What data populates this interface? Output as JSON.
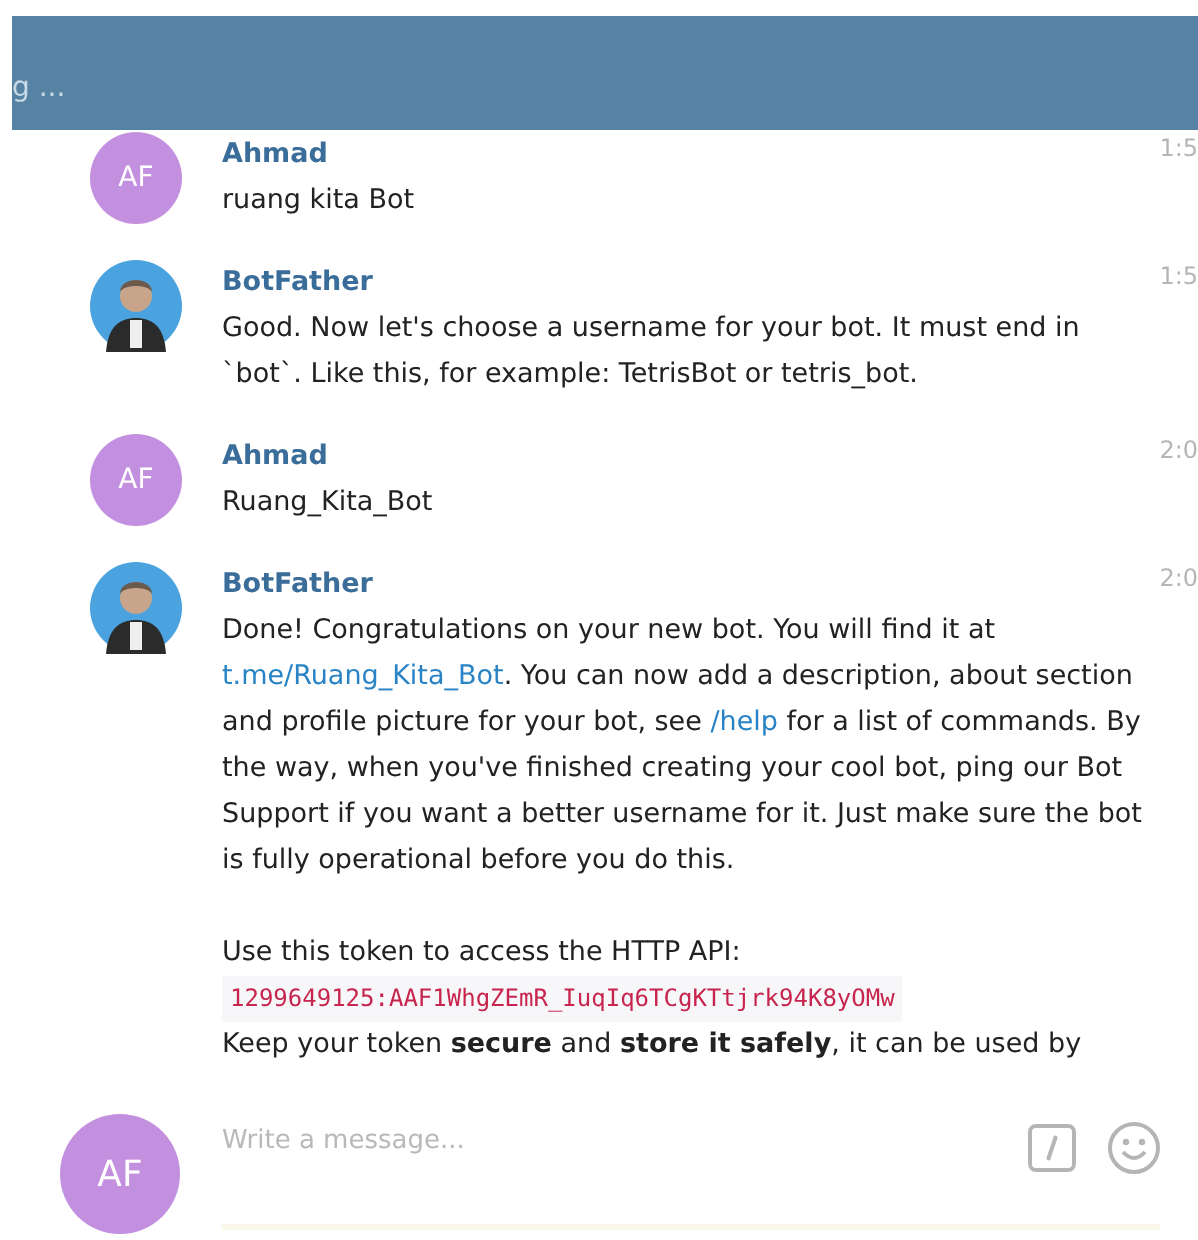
{
  "header": {
    "status": "g ..."
  },
  "messages": [
    {
      "sender": "Ahmad",
      "time": "1:5",
      "avatar": {
        "kind": "initials",
        "initials": "AF"
      },
      "blocks": [
        {
          "kind": "text",
          "text": "ruang kita Bot"
        }
      ]
    },
    {
      "sender": "BotFather",
      "time": "1:5",
      "avatar": {
        "kind": "photo"
      },
      "blocks": [
        {
          "kind": "text",
          "text": "Good. Now let's choose a username for your bot. It must end in `bot`. Like this, for example: TetrisBot or tetris_bot."
        }
      ]
    },
    {
      "sender": "Ahmad",
      "time": "2:0",
      "avatar": {
        "kind": "initials",
        "initials": "AF"
      },
      "blocks": [
        {
          "kind": "text",
          "text": "Ruang_Kita_Bot"
        }
      ]
    },
    {
      "sender": "BotFather",
      "time": "2:0",
      "avatar": {
        "kind": "photo"
      },
      "blocks": [
        {
          "kind": "paragraph",
          "segments": [
            {
              "kind": "text",
              "text": "Done! Congratulations on your new bot. You will find it at "
            },
            {
              "kind": "link",
              "text": "t.me/Ruang_Kita_Bot"
            },
            {
              "kind": "text",
              "text": ". You can now add a description, about section and profile picture for your bot, see "
            },
            {
              "kind": "link",
              "text": "/help"
            },
            {
              "kind": "text",
              "text": " for a list of commands. By the way, when you've finished creating your cool bot, ping our Bot Support if you want a better username for it. Just make sure the bot is fully operational before you do this."
            }
          ]
        },
        {
          "kind": "text",
          "text": "Use this token to access the HTTP API:"
        },
        {
          "kind": "code",
          "text": "1299649125:AAF1WhgZEmR_IuqIq6TCgKTtjrk94K8yOMw"
        },
        {
          "kind": "text",
          "text": "Keep your token **secure** and **store it safely**, it can be used by"
        }
      ]
    }
  ],
  "composer": {
    "avatar": {
      "initials": "AF"
    },
    "placeholder": "Write a message..."
  }
}
